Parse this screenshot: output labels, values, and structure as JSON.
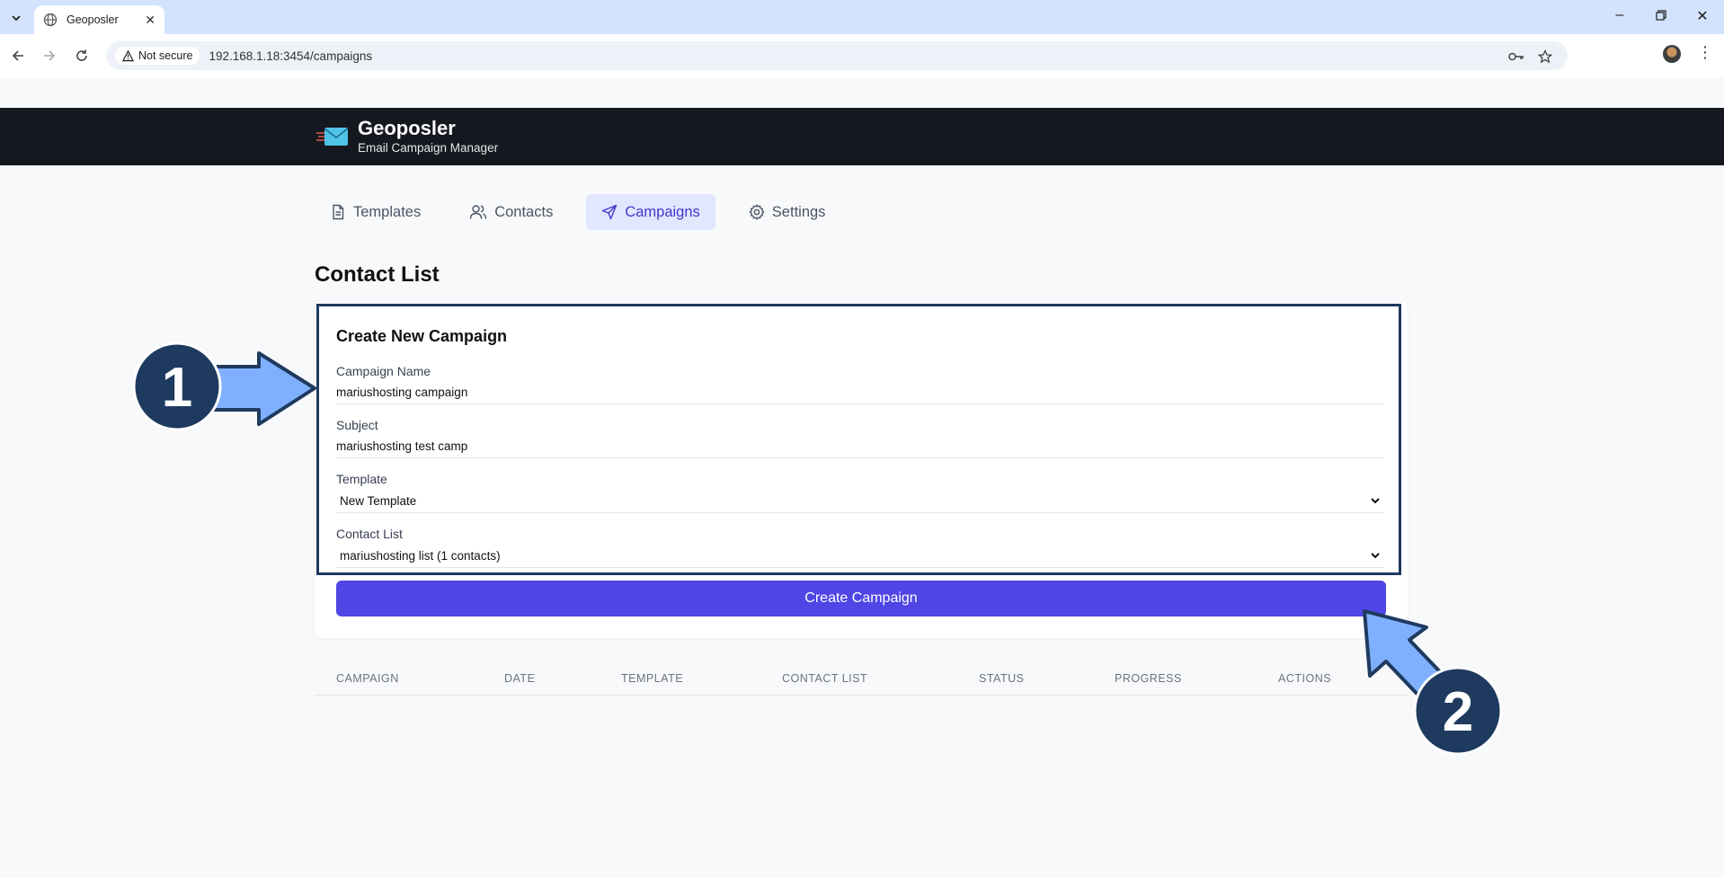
{
  "browser": {
    "tab_title": "Geoposler",
    "not_secure_label": "Not secure",
    "url": "192.168.1.18:3454/campaigns"
  },
  "app": {
    "brand_name": "Geoposler",
    "brand_subtitle": "Email Campaign Manager"
  },
  "nav": {
    "items": [
      {
        "label": "Templates",
        "icon": "document-icon"
      },
      {
        "label": "Contacts",
        "icon": "users-icon"
      },
      {
        "label": "Campaigns",
        "icon": "send-icon",
        "active": true
      },
      {
        "label": "Settings",
        "icon": "gear-icon"
      }
    ]
  },
  "page": {
    "title": "Contact List"
  },
  "form": {
    "title": "Create New Campaign",
    "campaign_name_label": "Campaign Name",
    "campaign_name_value": "mariushosting campaign",
    "subject_label": "Subject",
    "subject_value": "mariushosting test camp",
    "template_label": "Template",
    "template_value": "New Template",
    "contact_list_label": "Contact List",
    "contact_list_value": "mariushosting list (1 contacts)",
    "submit_label": "Create Campaign"
  },
  "table": {
    "headers": [
      "CAMPAIGN",
      "DATE",
      "TEMPLATE",
      "CONTACT LIST",
      "STATUS",
      "PROGRESS",
      "ACTIONS"
    ]
  },
  "annotations": {
    "step1": "1",
    "step2": "2",
    "arrow_color": "#7fb0ff",
    "badge_color": "#1e3a5f"
  },
  "colors": {
    "accent": "#4f46e5",
    "header_bg": "#161820",
    "active_nav_bg": "#e0e7ff"
  }
}
